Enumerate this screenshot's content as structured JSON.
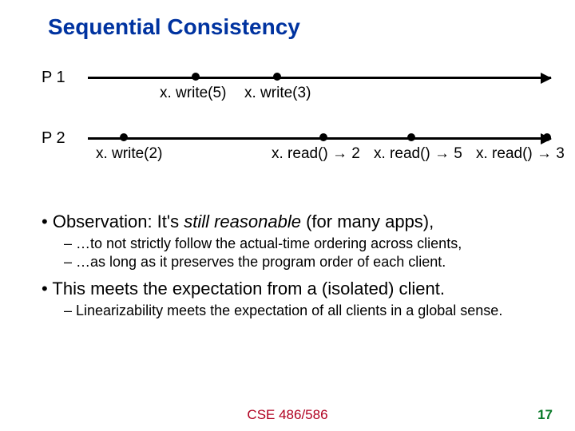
{
  "title": "Sequential Consistency",
  "p1_label": "P 1",
  "p2_label": "P 2",
  "p1_events": {
    "e0": "x. write(5)",
    "e1": "x. write(3)"
  },
  "p2_events": {
    "e0": "x. write(2)",
    "e1": "x. read() → 2",
    "e2": "x. read() → 5",
    "e3": "x. read() → 3"
  },
  "bullets": {
    "b1_pre": "Observation: It's ",
    "b1_em": "still reasonable",
    "b1_post": " (for many apps),",
    "s1": "– …to not strictly follow the actual-time ordering across clients,",
    "s2": "– …as long as it preserves the program order of each client.",
    "b2": "This meets the expectation from a (isolated) client.",
    "s3": "– Linearizability meets the expectation of all clients in a global sense."
  },
  "footer": "CSE 486/586",
  "page": "17"
}
